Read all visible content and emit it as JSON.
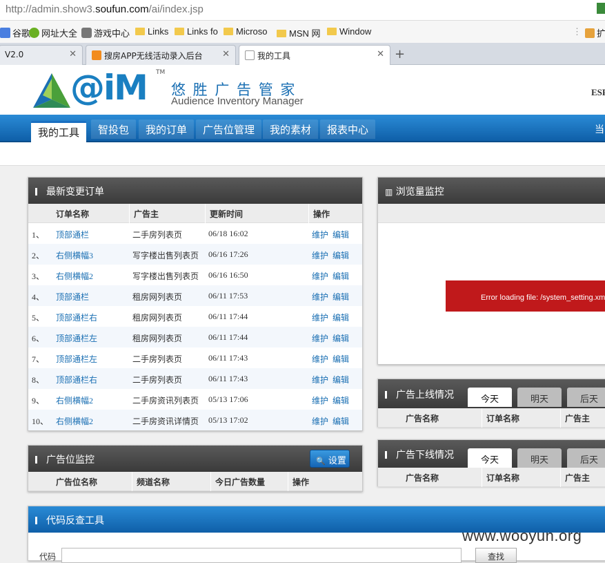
{
  "browser": {
    "url_prefix": "http://admin.show3.",
    "url_domain": "soufun.com",
    "url_path": "/ai/index.jsp",
    "bookmarks": [
      "谷歌",
      "网址大全",
      "游戏中心",
      "Links",
      "Links fo",
      "Microso",
      "MSN 网",
      "Window",
      "扩"
    ],
    "tabs": [
      {
        "label": "V2.0"
      },
      {
        "label": "搜房APP无线活动录入后台"
      },
      {
        "label": "我的工具"
      }
    ]
  },
  "header": {
    "logo_text": "@iM",
    "tm": "TM",
    "cn_title": "悠 胜 广 告 管 家",
    "en_title": "Audience Inventory Manager",
    "right_text": "ESF"
  },
  "nav": {
    "items": [
      "我的工具",
      "智投包",
      "我的订单",
      "广告位管理",
      "我的素材",
      "报表中心"
    ],
    "right": "当"
  },
  "orders": {
    "title": "最新变更订单",
    "columns": [
      "订单名称",
      "广告主",
      "更新时间",
      "操作"
    ],
    "rows": [
      {
        "idx": "1、",
        "name": "顶部通栏",
        "adv": "二手房列表页",
        "time": "06/18 16:02",
        "op1": "维护",
        "op2": "编辑"
      },
      {
        "idx": "2、",
        "name": "右侧横幅3",
        "adv": "写字楼出售列表页",
        "time": "06/16 17:26",
        "op1": "维护",
        "op2": "编辑"
      },
      {
        "idx": "3、",
        "name": "右侧横幅2",
        "adv": "写字楼出售列表页",
        "time": "06/16 16:50",
        "op1": "维护",
        "op2": "编辑"
      },
      {
        "idx": "4、",
        "name": "顶部通栏",
        "adv": "租房网列表页",
        "time": "06/11 17:53",
        "op1": "维护",
        "op2": "编辑"
      },
      {
        "idx": "5、",
        "name": "顶部通栏右",
        "adv": "租房网列表页",
        "time": "06/11 17:44",
        "op1": "维护",
        "op2": "编辑"
      },
      {
        "idx": "6、",
        "name": "顶部通栏左",
        "adv": "租房网列表页",
        "time": "06/11 17:44",
        "op1": "维护",
        "op2": "编辑"
      },
      {
        "idx": "7、",
        "name": "顶部通栏左",
        "adv": "二手房列表页",
        "time": "06/11 17:43",
        "op1": "维护",
        "op2": "编辑"
      },
      {
        "idx": "8、",
        "name": "顶部通栏右",
        "adv": "二手房列表页",
        "time": "06/11 17:43",
        "op1": "维护",
        "op2": "编辑"
      },
      {
        "idx": "9、",
        "name": "右侧横幅2",
        "adv": "二手房资讯列表页",
        "time": "05/13 17:06",
        "op1": "维护",
        "op2": "编辑"
      },
      {
        "idx": "10、",
        "name": "右侧横幅2",
        "adv": "二手房资讯详情页",
        "time": "05/13 17:02",
        "op1": "维护",
        "op2": "编辑"
      }
    ]
  },
  "traffic": {
    "title": "浏览量监控",
    "error": "Error loading file: /system_setting.xml"
  },
  "online": {
    "title": "广告上线情况",
    "tabs": [
      "今天",
      "明天",
      "后天"
    ],
    "columns": [
      "广告名称",
      "订单名称",
      "广告主"
    ]
  },
  "offline": {
    "title": "广告下线情况",
    "tabs": [
      "今天",
      "明天",
      "后天"
    ],
    "columns": [
      "广告名称",
      "订单名称",
      "广告主"
    ]
  },
  "adspace": {
    "title": "广告位监控",
    "button": "设置",
    "columns": [
      "广告位名称",
      "频道名称",
      "今日广告数量",
      "操作"
    ]
  },
  "codecheck": {
    "title": "代码反查工具",
    "label": "代码",
    "button": "查找"
  },
  "watermark": "www.wooyun.org"
}
